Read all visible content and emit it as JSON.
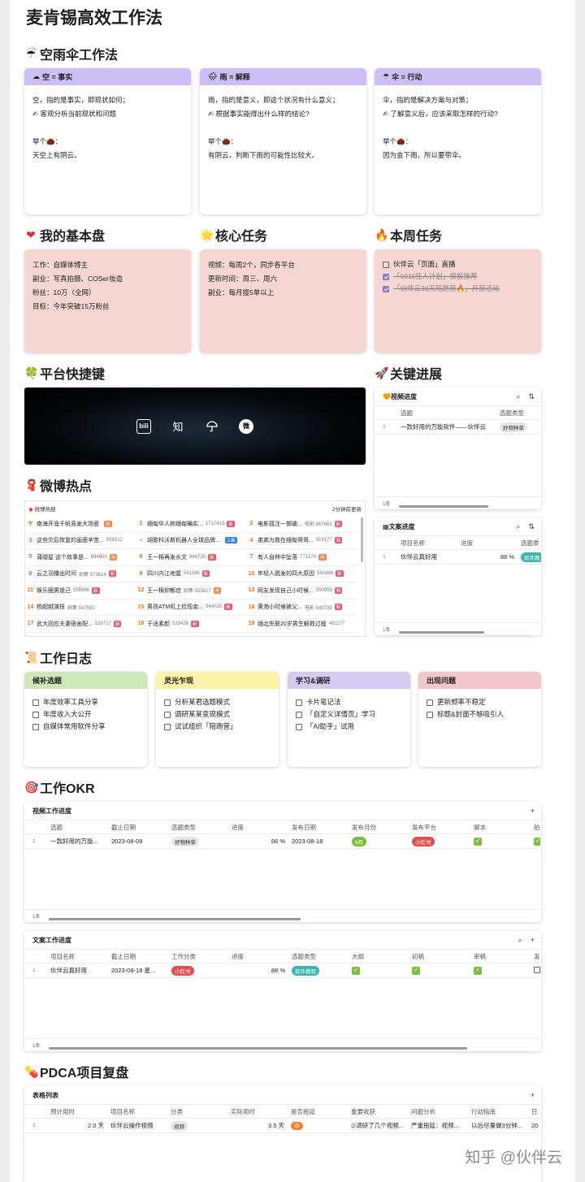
{
  "title": "麦肯锡高效工作法",
  "s1": {
    "icon": "☔",
    "title": "空雨伞工作法"
  },
  "cards": [
    {
      "icon": "☁",
      "head": "空 = 事实",
      "l1": "空，指的是事实，即现状如何；",
      "l2": "✍ 客观分析当前现状和问题",
      "l3": "举个🌰：",
      "l4": "天空上有阴云。"
    },
    {
      "icon": "🌧",
      "head": "雨 = 解释",
      "l1": "雨，指的是意义，即这个状况有什么意义；",
      "l2": "✍ 根据事实能得出什么样的结论?",
      "l3": "举个🌰：",
      "l4": "有阴云，判断下雨的可能性比较大。"
    },
    {
      "icon": "☂",
      "head": "伞 = 行动",
      "l1": "伞，指的是解决方案与对策；",
      "l2": "✍ 了解意义后，应该采取怎样的行动?",
      "l3": "举个🌰：",
      "l4": "因为会下雨，所以要带伞。"
    }
  ],
  "base": {
    "icon": "❤",
    "title": "我的基本盘",
    "lines": [
      "工作：自媒体博主",
      "副业：写真拍摄、COSer妆造",
      "粉丝：10万（全网）",
      "目标：今年突破15万粉丝"
    ]
  },
  "core": {
    "icon": "🌟",
    "title": "核心任务",
    "lines": [
      "视频：每周2个，同步各平台",
      "更新时间：周三、周六",
      "副业：每月接5单以上"
    ]
  },
  "week": {
    "icon": "🔥",
    "title": "本周任务",
    "items": [
      {
        "t": "伙伴云「页面」直播",
        "done": false
      },
      {
        "t": "「1011狂人计划」模板推荐",
        "done": true
      },
      {
        "t": "「伙伴云30天陪跑营🔥」开营活动",
        "done": true
      }
    ]
  },
  "plat": {
    "icon": "🍀",
    "title": "平台快捷键",
    "icons": [
      "bili",
      "知",
      "伞",
      "微"
    ]
  },
  "prog": {
    "icon": "🚀",
    "title": "关键进展"
  },
  "vprog": {
    "title": "视频进度",
    "icon": "🧡",
    "cols": [
      "选题",
      "选题类型"
    ],
    "row": [
      "一款好用的万能软件——伙伴云",
      "好物种草"
    ],
    "foot": "1条"
  },
  "wprog": {
    "title": "文案进度",
    "icon": "▦",
    "cols": [
      "项目名称",
      "进度",
      "选题类"
    ],
    "row": [
      "伙伴云真好用",
      "88 %",
      "软件教"
    ],
    "foot": "1条"
  },
  "weibo": {
    "icon": "🧣",
    "title": "微博热点",
    "top": "微博热搜",
    "updated": "2分钟前更新",
    "items": [
      {
        "r": "〒",
        "t": "南海开渔千帆竞发大场面",
        "n": "",
        "tag": "hot"
      },
      {
        "r": "1",
        "t": "缅甸华人称缅甸确实...",
        "n": "1717413",
        "tag": "new"
      },
      {
        "r": "2",
        "t": "电影孤注一掷被...",
        "n": "电影 967663",
        "tag": "new"
      },
      {
        "r": "3",
        "t": "这些灾后恢复的画面辛苦...",
        "n": "928312",
        "tag": ""
      },
      {
        "r": "•",
        "t": "胡歌科沃斯机器人全球品牌...",
        "n": "",
        "tag": "up"
      },
      {
        "r": "4",
        "t": "弟弟为救在缅甸哥哥...",
        "n": "919177",
        "tag": "new"
      },
      {
        "r": "5",
        "t": "蒲熠星 这个故事是...",
        "n": "894850",
        "tag": "hot"
      },
      {
        "r": "6",
        "t": "王一棉再发长文",
        "n": "866735",
        "tag": "new"
      },
      {
        "r": "7",
        "t": "有人自林中坠落",
        "n": "771274",
        "tag": "hot"
      },
      {
        "r": "8",
        "t": "云之羽播出时间",
        "n": "剧集 573614",
        "tag": "new"
      },
      {
        "r": "9",
        "t": "四川内江地震",
        "n": "561188",
        "tag": "new"
      },
      {
        "r": "10",
        "t": "年轻人脱发的四大原因",
        "n": "560486",
        "tag": "new"
      },
      {
        "r": "11",
        "t": "娱乐圈男姐己",
        "n": "555966",
        "tag": "new"
      },
      {
        "r": "12",
        "t": "王一棉抑郁症",
        "n": "剧集 553617",
        "tag": "hot"
      },
      {
        "r": "13",
        "t": "网友发现自己小时候...",
        "n": "550959",
        "tag": "new"
      },
      {
        "r": "14",
        "t": "杨超越演技",
        "n": "剧集 547593",
        "tag": ""
      },
      {
        "r": "15",
        "t": "男孩ATM机上捡现金...",
        "n": "544025",
        "tag": "new"
      },
      {
        "r": "16",
        "t": "黄渤小时候被父...",
        "n": "电影 543739",
        "tag": "new"
      },
      {
        "r": "17",
        "t": "武大回应夫妻宿舍配...",
        "n": "539717",
        "tag": "new"
      },
      {
        "r": "18",
        "t": "于适素颜",
        "n": "539436",
        "tag": "new"
      },
      {
        "r": "19",
        "t": "缅北失联20岁男生解救过程",
        "n": "481177",
        "tag": ""
      }
    ]
  },
  "log": {
    "icon": "📜",
    "title": "工作日志",
    "cols": [
      {
        "head": "候补选题",
        "color": "#cfe8b8",
        "items": [
          "年度效率工具分享",
          "年度收入大公开",
          "自媒体常用软件分享"
        ]
      },
      {
        "head": "灵光乍现",
        "color": "#fbf3a7",
        "items": [
          "分析某君选题模式",
          "调研某某变现模式",
          "试试组织「陪跑营」"
        ]
      },
      {
        "head": "学习&调研",
        "color": "#d5cbf0",
        "items": [
          "卡片笔记法",
          "「自定义详情页」学习",
          "「AI助手」试用"
        ]
      },
      {
        "head": "出现问题",
        "color": "#f1c7cc",
        "items": [
          "更新频率不稳定",
          "标题&封面不够吸引人"
        ]
      }
    ]
  },
  "okr": {
    "icon": "🎯",
    "title": "工作OKR"
  },
  "t1": {
    "title": "视频工作进度",
    "cols": [
      "选题",
      "截止日期",
      "选题类型",
      "进度",
      "发布日期",
      "发布月份",
      "发布平台",
      "脚本",
      "拍"
    ],
    "row": [
      "一款好用的万能...",
      "2023-08-09",
      "好物种草",
      "66 %",
      "2023-08-18",
      "8月",
      "小红书",
      "✓",
      "✓"
    ],
    "foot": "1条"
  },
  "t2": {
    "title": "文案工作进度",
    "cols": [
      "项目名称",
      "截止日期",
      "工作分类",
      "进度",
      "选题类型",
      "大纲",
      "初稿",
      "审稿",
      "发"
    ],
    "row": [
      "伙伴云真好用",
      "2023-08-18 星...",
      "小红书",
      "88 %",
      "软件教程",
      "✓",
      "✓",
      "✓",
      ""
    ],
    "foot": "1条"
  },
  "pdca": {
    "icon": "💊",
    "title": "PDCA项目复盘",
    "table": "表格列表",
    "cols": [
      "预计用时",
      "项目名称",
      "分类",
      "实际用时",
      "是否拖延",
      "重要收获",
      "问题分析",
      "行动指南",
      "日"
    ],
    "row": [
      "2.0 天",
      "伙伴云操作视频",
      "视频",
      "3.5 天",
      "😡",
      "⊙调研了几个视频...",
      "严重拖延：视频...",
      "以后尽量做3分钟...",
      "20"
    ]
  },
  "watermark": "知乎 @伙伴云"
}
